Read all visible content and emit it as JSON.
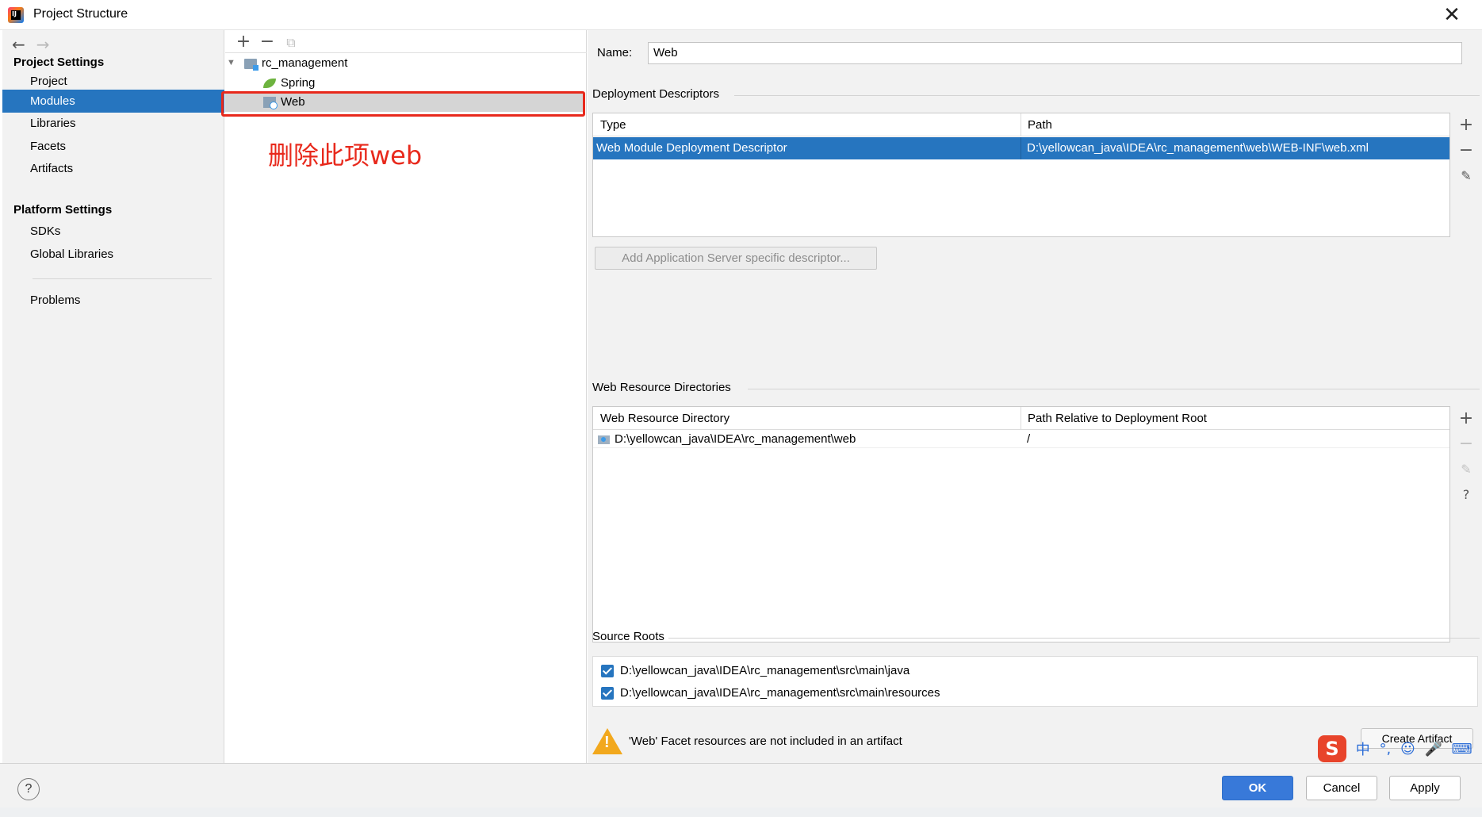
{
  "window": {
    "title": "Project Structure",
    "close_glyph": "✕"
  },
  "nav": {
    "back_glyph": "←",
    "forward_glyph": "→",
    "project_settings_title": "Project Settings",
    "project_items": [
      "Project",
      "Modules",
      "Libraries",
      "Facets",
      "Artifacts"
    ],
    "selected_item": "Modules",
    "platform_settings_title": "Platform Settings",
    "platform_items": [
      "SDKs",
      "Global Libraries"
    ],
    "problems": "Problems"
  },
  "tree": {
    "toolbar": {
      "add": "+",
      "remove": "−",
      "copy": "⧉"
    },
    "expand_glyph": "▼",
    "root": "rc_management",
    "children": [
      "Spring",
      "Web"
    ],
    "selected": "Web",
    "annotation": "删除此项web"
  },
  "facet": {
    "name_label": "Name:",
    "name_value": "Web",
    "deployment": {
      "title": "Deployment Descriptors",
      "headers": [
        "Type",
        "Path"
      ],
      "rows": [
        {
          "type": "Web Module Deployment Descriptor",
          "path": "D:\\yellowcan_java\\IDEA\\rc_management\\web\\WEB-INF\\web.xml"
        }
      ],
      "add_server_button": "Add Application Server specific descriptor..."
    },
    "resources": {
      "title": "Web Resource Directories",
      "headers": [
        "Web Resource Directory",
        "Path Relative to Deployment Root"
      ],
      "rows": [
        {
          "directory": "D:\\yellowcan_java\\IDEA\\rc_management\\web",
          "relative": "/"
        }
      ]
    },
    "source_roots": {
      "title": "Source Roots",
      "items": [
        "D:\\yellowcan_java\\IDEA\\rc_management\\src\\main\\java",
        "D:\\yellowcan_java\\IDEA\\rc_management\\src\\main\\resources"
      ]
    },
    "warning": "'Web' Facet resources are not included in an artifact",
    "create_artifact_button": "Create Artifact"
  },
  "side_tools": {
    "add": "+",
    "remove": "−",
    "edit": "✎",
    "help": "?"
  },
  "ime": {
    "logo": "S",
    "chinese": "中",
    "punct": "°,",
    "emoji": "☺",
    "mic": "🎤",
    "keyboard": "⌨"
  },
  "footer": {
    "help": "?",
    "ok": "OK",
    "cancel": "Cancel",
    "apply": "Apply"
  },
  "colors": {
    "selection": "#2675bf",
    "annotation": "#e8291c",
    "ok_button": "#3879d9",
    "warning": "#f2a81d"
  }
}
